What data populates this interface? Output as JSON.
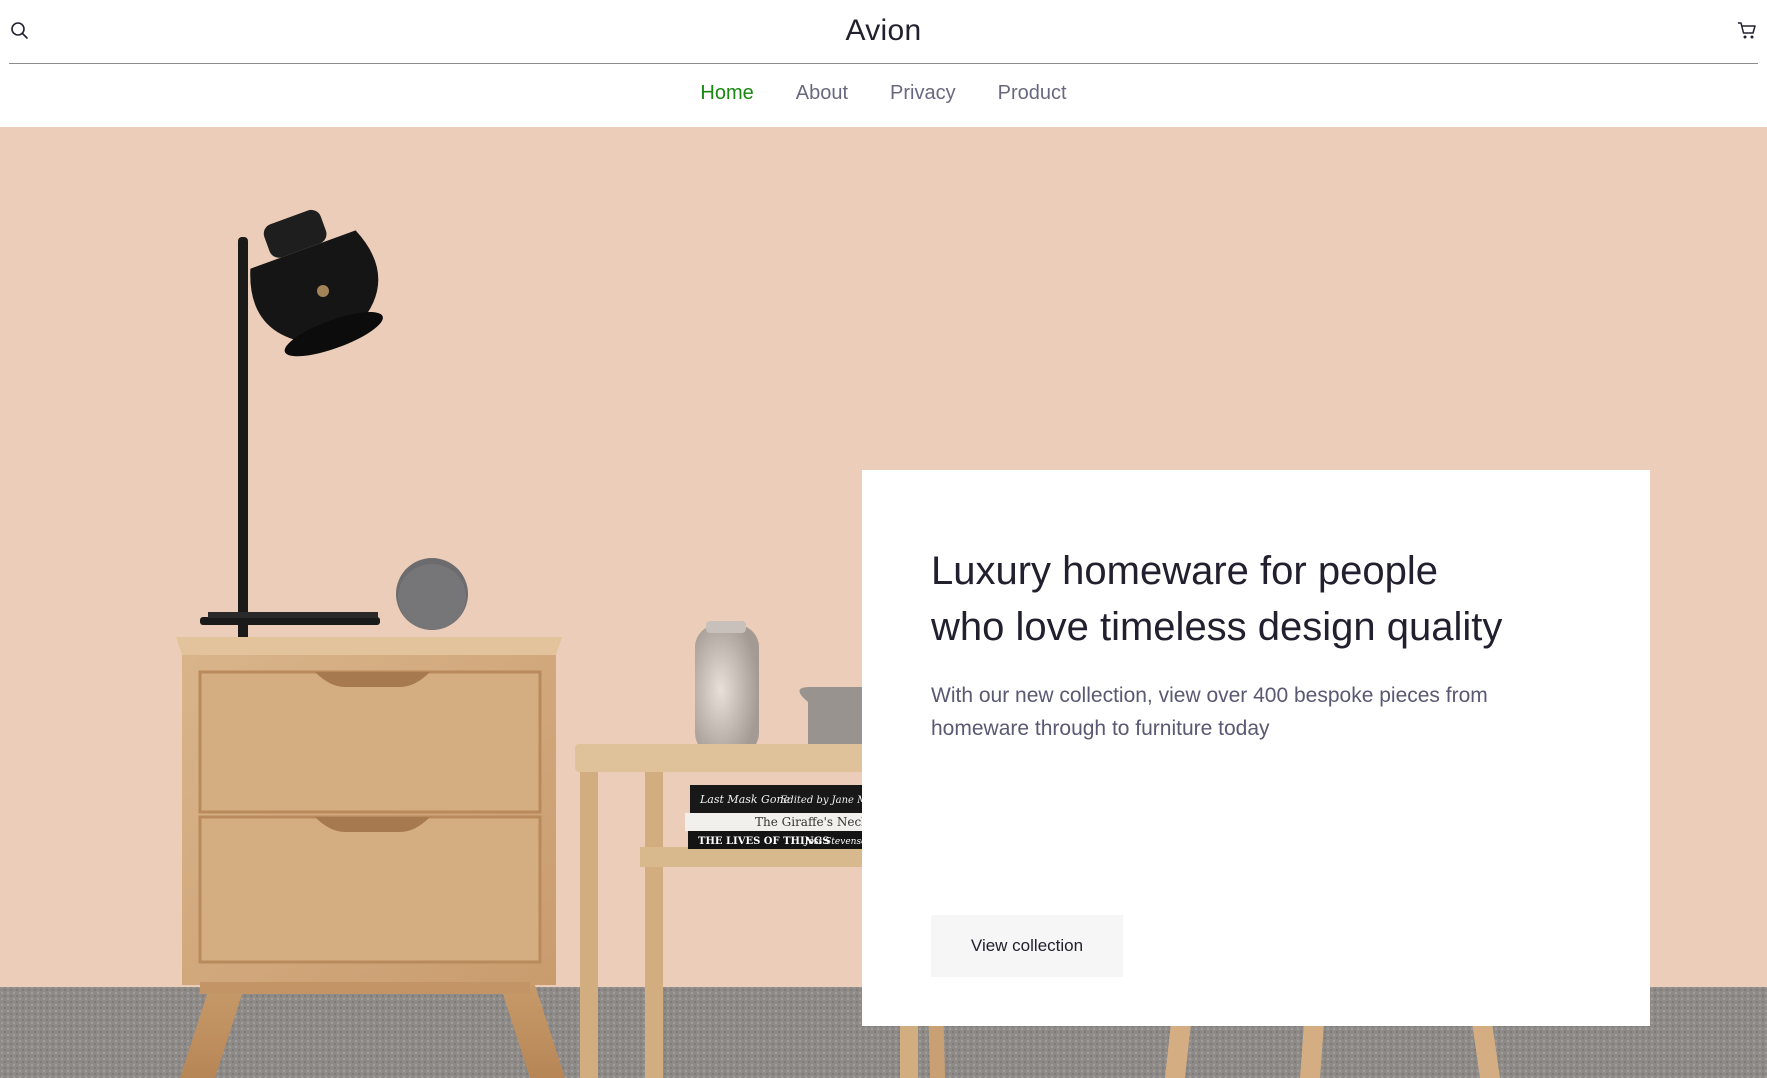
{
  "header": {
    "brand": "Avion",
    "icons": {
      "search": "search-icon",
      "cart": "cart-icon"
    }
  },
  "nav": {
    "items": [
      {
        "label": "Home",
        "active": true
      },
      {
        "label": "About",
        "active": false
      },
      {
        "label": "Privacy",
        "active": false
      },
      {
        "label": "Product",
        "active": false
      }
    ],
    "active_color": "#18880f"
  },
  "hero": {
    "title_line1": "Luxury homeware for people",
    "title_line2": "who love timeless design quality",
    "description": "With our new collection, view over 400 bespoke pieces from homeware through to furniture today",
    "cta_label": "View collection",
    "books": [
      "Last Mask Gone",
      "Edited by Jane Morgan",
      "The Giraffe's Neck",
      "THE LIVES OF THINGS",
      "Jost Stevenson"
    ]
  },
  "colors": {
    "wall": "#ecceba",
    "text_dark": "#22202e",
    "text_muted": "#5a5872"
  }
}
